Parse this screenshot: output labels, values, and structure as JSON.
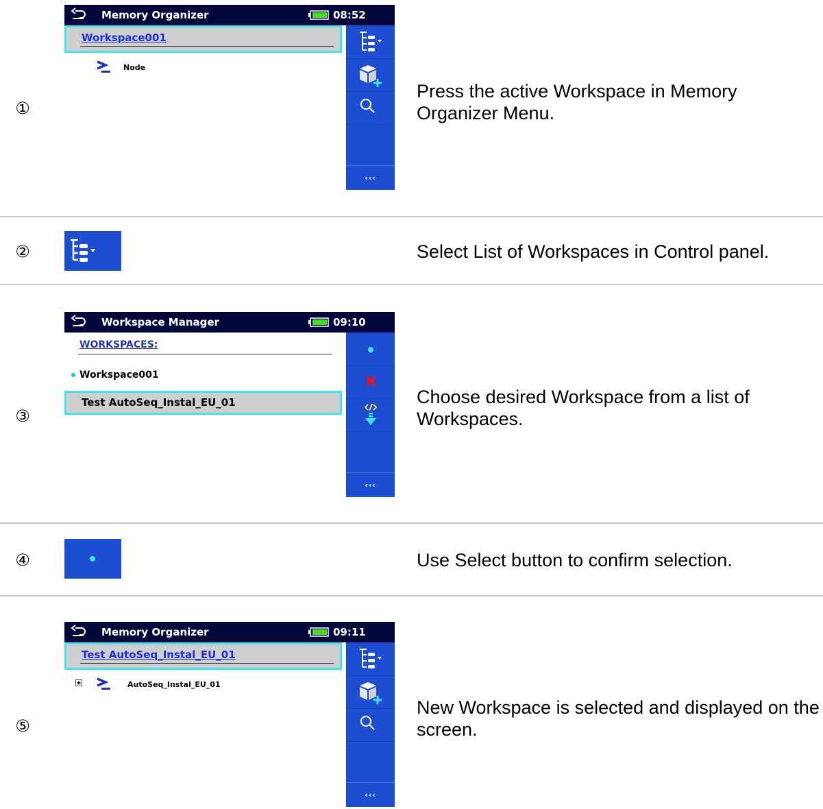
{
  "steps": [
    {
      "num": "①",
      "desc": "Press the active Workspace in Memory Organizer Menu."
    },
    {
      "num": "②",
      "desc": "Select List of Workspaces in Control panel."
    },
    {
      "num": "③",
      "desc": "Choose desired Workspace from a list of Workspaces."
    },
    {
      "num": "④",
      "desc": "Use Select button to confirm selection."
    },
    {
      "num": "⑤",
      "desc": "New Workspace is selected and displayed on the screen."
    }
  ],
  "screen1": {
    "title": "Memory Organizer",
    "time": "08:52",
    "selected": "Workspace001",
    "node": "Node",
    "more": "‹‹‹"
  },
  "screen3": {
    "title": "Workspace Manager",
    "time": "09:10",
    "heading": "WORKSPACES:",
    "item_active": "Workspace001",
    "item_selected": "Test AutoSeq_Instal_EU_01",
    "more": "‹‹‹"
  },
  "screen5": {
    "title": "Memory Organizer",
    "time": "09:11",
    "selected": "Test AutoSeq_Instal_EU_01",
    "node": "AutoSeq_Instal_EU_01",
    "more": "‹‹‹"
  },
  "colors": {
    "header": "#03063a",
    "panel": "#1d4ed1",
    "highlight_border": "#3ee6f0",
    "selected_text": "#1a2fd0",
    "heading_text": "#2433b4"
  }
}
